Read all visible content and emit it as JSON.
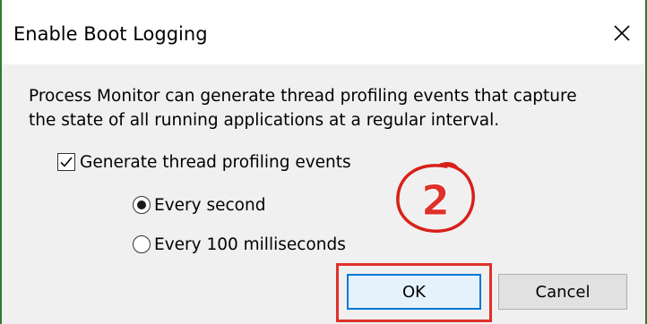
{
  "window": {
    "title": "Enable Boot Logging"
  },
  "description": {
    "line1": "Process Monitor can generate thread profiling events that capture",
    "line2": "the state of all running applications at a regular interval."
  },
  "profiling": {
    "checkbox_label": "Generate thread profiling events",
    "checked": true
  },
  "interval": {
    "options": [
      {
        "label": "Every second",
        "selected": true
      },
      {
        "label": "Every 100 milliseconds",
        "selected": false
      }
    ]
  },
  "annotation": {
    "step_number": "2",
    "color": "#e0302a"
  },
  "buttons": {
    "ok_label": "OK",
    "cancel_label": "Cancel"
  },
  "colors": {
    "accent": "#0078d7",
    "window_border": "#2e7d32",
    "highlight": "#e0302a"
  }
}
